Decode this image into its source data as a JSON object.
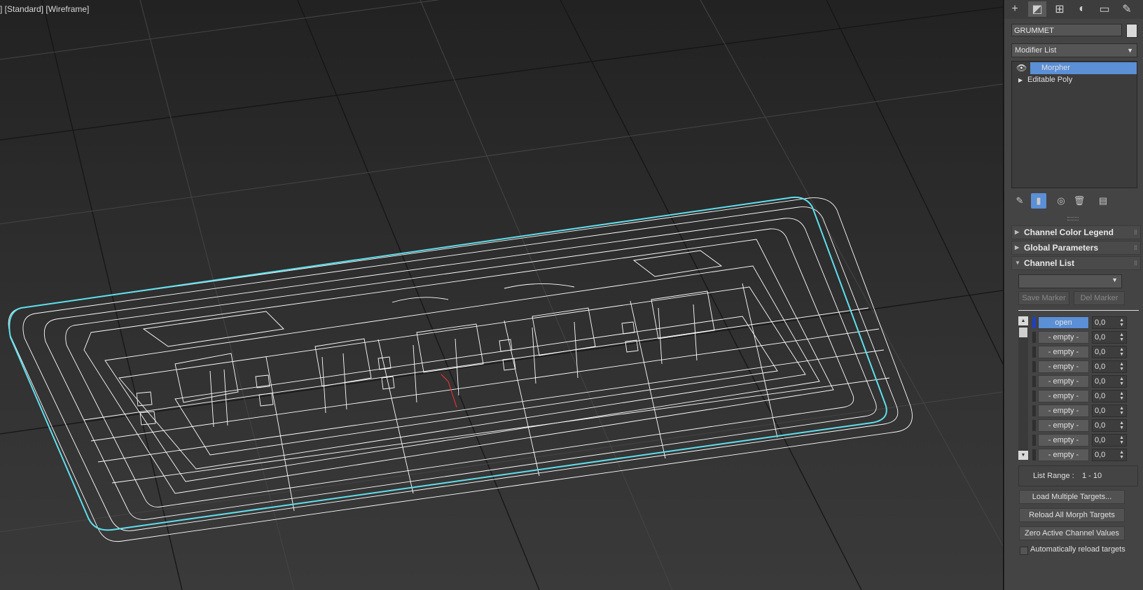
{
  "viewport": {
    "label": "] [Standard] [Wireframe]"
  },
  "command_panel": {
    "tabs": [
      {
        "icon": "create-icon",
        "glyph": "+"
      },
      {
        "icon": "modify-icon",
        "glyph": "◩"
      },
      {
        "icon": "hierarchy-icon",
        "glyph": "⊞"
      },
      {
        "icon": "motion-icon",
        "glyph": "◐"
      },
      {
        "icon": "display-icon",
        "glyph": "▭"
      },
      {
        "icon": "utilities-icon",
        "glyph": "✎"
      }
    ],
    "object_name": "GRUMMET",
    "modifier_list_label": "Modifier List",
    "stack": [
      {
        "label": "Morpher",
        "selected": true
      },
      {
        "label": "Editable Poly",
        "selected": false
      }
    ],
    "rollouts": {
      "channel_color_legend": "Channel Color Legend",
      "global_parameters": "Global Parameters",
      "channel_list": "Channel List"
    },
    "markers": {
      "save_marker": "Save Marker",
      "del_marker": "Del Marker"
    },
    "channels": [
      {
        "name": "open",
        "value": "0,0",
        "active": true
      },
      {
        "name": "- empty -",
        "value": "0,0",
        "active": false
      },
      {
        "name": "- empty -",
        "value": "0,0",
        "active": false
      },
      {
        "name": "- empty -",
        "value": "0,0",
        "active": false
      },
      {
        "name": "- empty -",
        "value": "0,0",
        "active": false
      },
      {
        "name": "- empty -",
        "value": "0,0",
        "active": false
      },
      {
        "name": "- empty -",
        "value": "0,0",
        "active": false
      },
      {
        "name": "- empty -",
        "value": "0,0",
        "active": false
      },
      {
        "name": "- empty -",
        "value": "0,0",
        "active": false
      },
      {
        "name": "- empty -",
        "value": "0,0",
        "active": false
      }
    ],
    "list_range_label": "List Range :",
    "list_range_value": "1 - 10",
    "buttons": {
      "load_multiple_targets": "Load Multiple Targets...",
      "reload_all_morph_targets": "Reload All Morph Targets",
      "zero_active_channel_values": "Zero Active Channel Values"
    },
    "auto_reload_label": "Automatically reload targets",
    "colors": {
      "selection_blue": "#5b8fd6",
      "wire_highlight": "#5fe0ee",
      "channel_marker_blue": "#2040c0"
    }
  }
}
